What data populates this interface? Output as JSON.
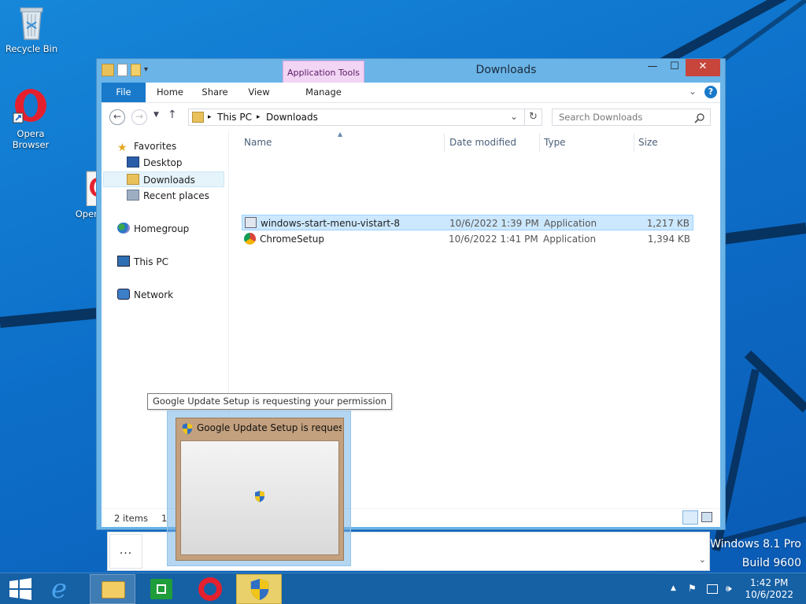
{
  "desktop": {
    "icons": {
      "recycle_bin": "Recycle Bin",
      "opera_line1": "Opera",
      "opera_line2": "Browser",
      "opera_setup": "OperaS"
    },
    "watermark_line1": "Windows 8.1 Pro",
    "watermark_line2": "Build 9600"
  },
  "window": {
    "title": "Downloads",
    "contextual_tab_group": "Application Tools",
    "ribbon_tabs": {
      "file": "File",
      "home": "Home",
      "share": "Share",
      "view": "View",
      "manage": "Manage"
    },
    "minimize_glyph": "—",
    "maximize_glyph": "☐",
    "close_glyph": "✕",
    "help_glyph": "?",
    "expand_glyph": "⌄",
    "address": {
      "segment_1": "This PC",
      "segment_2": "Downloads",
      "separator": "▸"
    },
    "search_placeholder": "Search Downloads",
    "nav": {
      "favorites": "Favorites",
      "desktop": "Desktop",
      "downloads": "Downloads",
      "recent": "Recent places",
      "homegroup": "Homegroup",
      "this_pc": "This PC",
      "network": "Network"
    },
    "columns": {
      "name": "Name",
      "date": "Date modified",
      "type": "Type",
      "size": "Size"
    },
    "files": [
      {
        "name": "windows-start-menu-vistart-8",
        "date": "10/6/2022 1:39 PM",
        "type": "Application",
        "size": "1,217 KB"
      },
      {
        "name": "ChromeSetup",
        "date": "10/6/2022 1:41 PM",
        "type": "Application",
        "size": "1,394 KB"
      }
    ],
    "status_items": "2 items",
    "status_trailing": "1"
  },
  "taskbar_preview": {
    "tooltip": "Google Update Setup is requesting your permission",
    "thumbnail_title": "Google Update Setup is requesti..."
  },
  "lower_panel": {
    "more_glyph": "..."
  },
  "clock": {
    "time": "1:42 PM",
    "date": "10/6/2022"
  },
  "colors": {
    "desktop_blue": "#0d6fc9",
    "taskbar": "#1660a4",
    "file_tab": "#1979ca",
    "context_tab": "#f2d4f4",
    "close_button": "#c7453b",
    "selection": "#cce8ff"
  }
}
